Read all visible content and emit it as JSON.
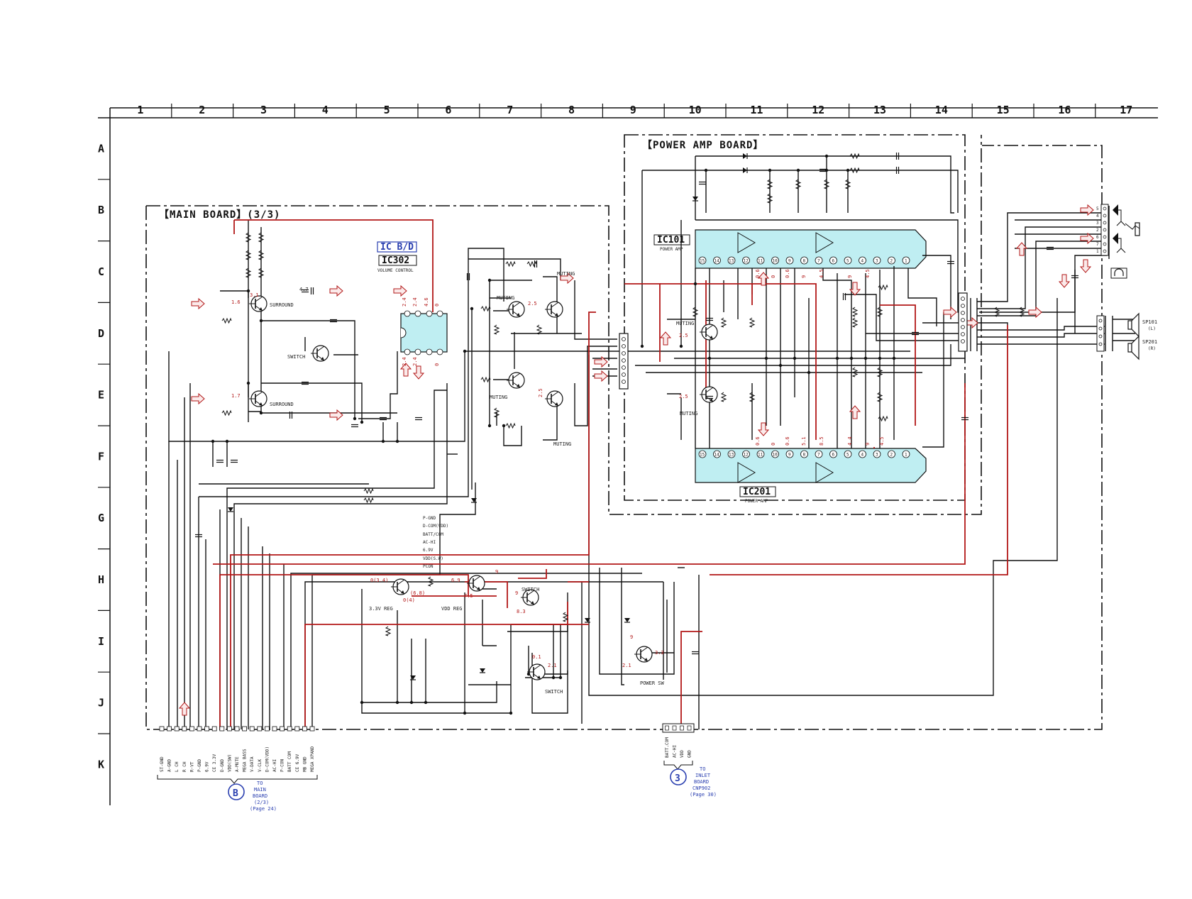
{
  "grid": {
    "columns": [
      "1",
      "2",
      "3",
      "4",
      "5",
      "6",
      "7",
      "8",
      "9",
      "10",
      "11",
      "12",
      "13",
      "14",
      "15",
      "16",
      "17"
    ],
    "rows": [
      "A",
      "B",
      "C",
      "D",
      "E",
      "F",
      "G",
      "H",
      "I",
      "J",
      "K"
    ]
  },
  "boards": {
    "main": "【MAIN BOARD】(3/3)",
    "power_amp": "【POWER AMP BOARD】"
  },
  "ics": {
    "ic302": {
      "tag": "IC B/D",
      "name": "IC302",
      "desc": "VOLUME CONTROL"
    },
    "ic101": {
      "name": "IC101",
      "desc": "POWER AMP"
    },
    "ic201": {
      "name": "IC201",
      "desc": "POWER AMP"
    }
  },
  "transistor_labels": {
    "surround_top": "SURROUND",
    "surround_bottom": "SURROUND",
    "switch_mid": "SWITCH",
    "muting_c8": "MUTING",
    "muting_d7": "MUTING",
    "muting_e7": "MUTING",
    "muting_f8": "MUTING",
    "muting_d10": "MUTING",
    "muting_e10": "MUTING",
    "reg33": "3.3V REG",
    "vdd_reg": "VDD REG",
    "switch_h8": "SWITCH",
    "switch_j8": "SWITCH",
    "power_sw": "POWER SW"
  },
  "bus_labels": [
    "P-GND",
    "D-COM(VDD)",
    "BATT/COM",
    "AC-HI",
    "6.9V",
    "VDD(S.W)",
    "PCON"
  ],
  "voltages": {
    "v_16": "1.6",
    "v_17": "1.7",
    "v_31": "3.1",
    "v_47": "4.7",
    "v_24a": "2.4",
    "v_24b": "2.4",
    "v_46": "4.6",
    "v_0a": "0",
    "v_24c": "2.4",
    "v_24d": "2.4",
    "v_0b": "0",
    "v_25a": "2.5",
    "v_25b": "2.5",
    "v_25c": "2.5",
    "v_25d": "2.5",
    "v_034": "0(3.4)",
    "v_68": "(6.8)",
    "v_04": "0(4)",
    "v_69": "6.9",
    "v_75": "7.5",
    "v_9a": "9",
    "v_9b": "9",
    "v_9c": "9",
    "v_83": "8.3",
    "v_01": "0.1",
    "v_21a": "2.1",
    "v_21b": "2.1",
    "v_33": "3.3"
  },
  "ic101_pins_top": [
    "15",
    "14",
    "13",
    "12",
    "11",
    "10",
    "9",
    "8",
    "7",
    "6",
    "5",
    "4",
    "3",
    "2",
    "1"
  ],
  "ic101_volts": [
    "0.6",
    "0",
    "0.6",
    "9",
    "4.5",
    "9",
    "4.5"
  ],
  "ic201_pins": [
    "15",
    "14",
    "13",
    "12",
    "11",
    "10",
    "9",
    "8",
    "7",
    "6",
    "5",
    "4",
    "3",
    "2",
    "1"
  ],
  "ic201_volts": [
    "0.6",
    "0",
    "0.6",
    "5.1",
    "8.5",
    "4.4",
    "9",
    "4.5"
  ],
  "connector_b": {
    "pins": [
      "ST-GND",
      "A-GND",
      "L CH",
      "R CH",
      "R-VT",
      "P-GND",
      "6.9V",
      "CE 3.3V",
      "D-GND",
      "VDD(SW)",
      "A-MUTE",
      "MEGA BASS",
      "V-DATA",
      "V-CLK",
      "D-COM(VDD)",
      "AC-HI",
      "P-CON",
      "BATT COM",
      "CE 6.9V",
      "MB GND",
      "MEGA XPAND"
    ],
    "badge": "B",
    "note_line1": "TO",
    "note_line2": "MAIN",
    "note_line3": "BOARD",
    "note_line4": "(2/3)",
    "note_line5": "(Page 24)"
  },
  "connector_3": {
    "pins": [
      "BATT.COM",
      "AC-HI",
      "VDD",
      "GND"
    ],
    "badge": "3",
    "note_line1": "TO",
    "note_line2": "INLET",
    "note_line3": "BOARD",
    "note_line4": "CNP902",
    "note_line5": "(Page 30)"
  },
  "speakers": {
    "sp101": "SP101",
    "sp101_ch": "(L)",
    "sp201": "SP201",
    "sp201_ch": "(R)"
  },
  "jack_pins": [
    "5",
    "4",
    "3",
    "2",
    "6",
    "7",
    "1"
  ],
  "colors": {
    "wire": "#111111",
    "signal_red": "#b21818",
    "ic_fill": "#bfeef2",
    "note_blue": "#2a3fb0"
  }
}
